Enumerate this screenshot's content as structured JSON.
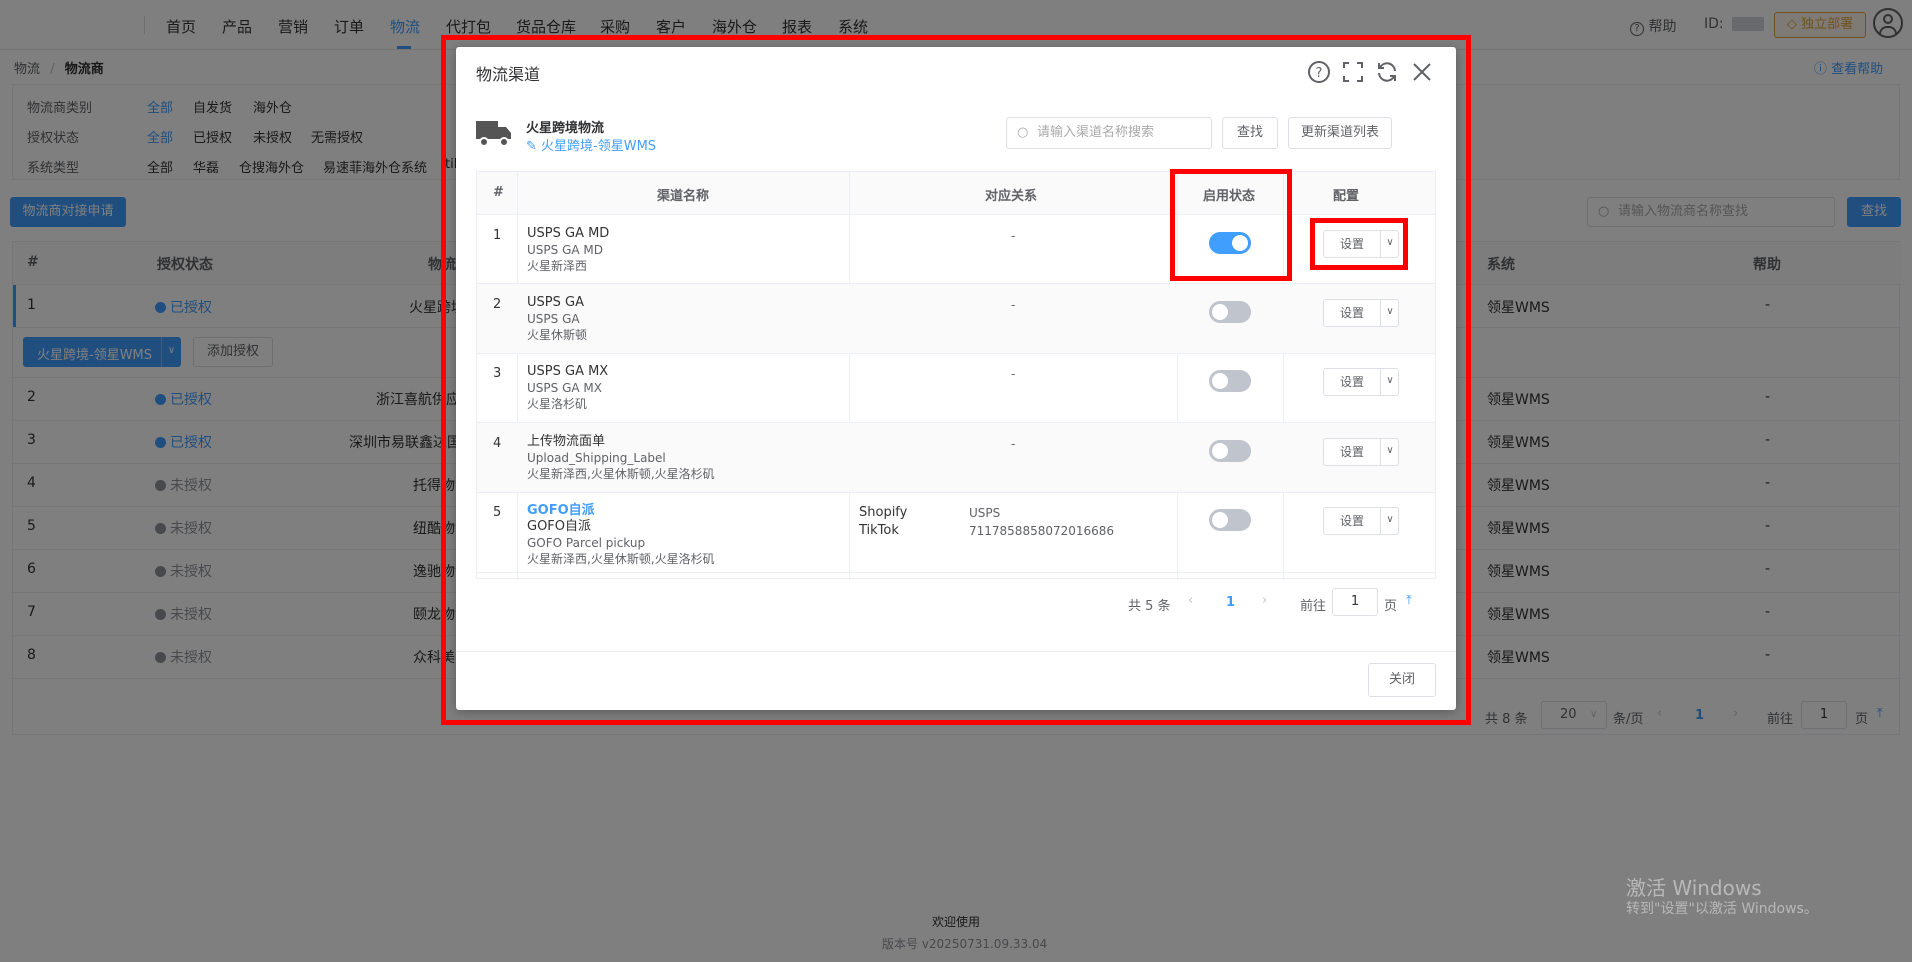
{
  "nav": {
    "items": [
      "首页",
      "产品",
      "营销",
      "订单",
      "物流",
      "代打包",
      "货品仓库",
      "采购",
      "客户",
      "海外仓",
      "报表",
      "系统"
    ],
    "active": "物流",
    "help": "帮助",
    "id_label": "ID:",
    "deploy": "独立部署"
  },
  "breadcrumb": {
    "root": "物流",
    "sep": "/",
    "current": "物流商"
  },
  "help_link": "查看帮助",
  "filters": {
    "rows": [
      {
        "label": "物流商类别",
        "options": [
          "全部",
          "自发货",
          "海外仓"
        ],
        "active": "全部"
      },
      {
        "label": "授权状态",
        "options": [
          "全部",
          "已授权",
          "未授权",
          "无需授权"
        ],
        "active": "全部"
      },
      {
        "label": "系统类型",
        "options": [
          "全部",
          "华磊",
          "仓搜海外仓",
          "易速菲海外仓系统",
          "til"
        ],
        "active": ""
      }
    ]
  },
  "apply_button": "物流商对接申请",
  "search": {
    "placeholder": "请输入物流商名称查找",
    "button": "查找"
  },
  "table": {
    "headers": [
      "#",
      "授权状态",
      "物流",
      "系统",
      "帮助"
    ],
    "rows": [
      {
        "idx": "1",
        "status": "已授权",
        "authorized": true,
        "name": "火星跨境",
        "system": "领星WMS",
        "help": "-"
      },
      {
        "idx": "2",
        "status": "已授权",
        "authorized": true,
        "name": "浙江喜航供应链",
        "system": "领星WMS",
        "help": "-"
      },
      {
        "idx": "3",
        "status": "已授权",
        "authorized": true,
        "name": "深圳市易联鑫达国际",
        "system": "领星WMS",
        "help": "-"
      },
      {
        "idx": "4",
        "status": "未授权",
        "authorized": false,
        "name": "托得物流",
        "system": "领星WMS",
        "help": "-"
      },
      {
        "idx": "5",
        "status": "未授权",
        "authorized": false,
        "name": "纽酷物流",
        "system": "领星WMS",
        "help": "-"
      },
      {
        "idx": "6",
        "status": "未授权",
        "authorized": false,
        "name": "逸驰物流",
        "system": "领星WMS",
        "help": "-"
      },
      {
        "idx": "7",
        "status": "未授权",
        "authorized": false,
        "name": "颐龙物流",
        "system": "领星WMS",
        "help": "-"
      },
      {
        "idx": "8",
        "status": "未授权",
        "authorized": false,
        "name": "众科美",
        "system": "领星WMS",
        "help": "-"
      }
    ],
    "expanded": {
      "account_button": "火星跨境-领星WMS",
      "add_button": "添加授权"
    }
  },
  "pager": {
    "total": "共 8 条",
    "size": "20",
    "per_page": "条/页",
    "page": "1",
    "goto": "前往",
    "goto_val": "1",
    "page_unit": "页"
  },
  "footer": {
    "welcome": "欢迎使用",
    "version": "版本号 v20250731.09.33.04"
  },
  "watermark": {
    "title": "激活 Windows",
    "sub": "转到\"设置\"以激活 Windows。"
  },
  "modal": {
    "title": "物流渠道",
    "provider_name": "火星跨境物流",
    "provider_link": "火星跨境-领星WMS",
    "search_placeholder": "请输入渠道名称搜索",
    "search_button": "查找",
    "refresh_button": "更新渠道列表",
    "headers": [
      "#",
      "渠道名称",
      "对应关系",
      "启用状态",
      "配置"
    ],
    "rows": [
      {
        "idx": "1",
        "name": "USPS GA MD",
        "code": "USPS GA MD",
        "wh": "火星新泽西",
        "map": "-",
        "enabled": true
      },
      {
        "idx": "2",
        "name": "USPS GA",
        "code": "USPS GA",
        "wh": "火星休斯顿",
        "map": "-",
        "enabled": false
      },
      {
        "idx": "3",
        "name": "USPS GA MX",
        "code": "USPS GA MX",
        "wh": "火星洛杉矶",
        "map": "-",
        "enabled": false
      },
      {
        "idx": "4",
        "name": "上传物流面单",
        "code": "Upload_Shipping_Label",
        "wh": "火星新泽西,火星休斯顿,火星洛杉矶",
        "map": "-",
        "enabled": false
      },
      {
        "idx": "5",
        "name": "GOFO自派",
        "name2": "GOFO自派",
        "code": "GOFO Parcel pickup",
        "wh": "火星新泽西,火星休斯顿,火星洛杉矶",
        "map_rows": [
          {
            "k": "Shopify",
            "v": "USPS"
          },
          {
            "k": "TikTok",
            "v": "7117858858072016686"
          }
        ],
        "enabled": false
      }
    ],
    "setting_label": "设置",
    "pager": {
      "total": "共 5 条",
      "page": "1",
      "goto": "前往",
      "goto_val": "1",
      "page_unit": "页"
    },
    "close_button": "关闭"
  }
}
